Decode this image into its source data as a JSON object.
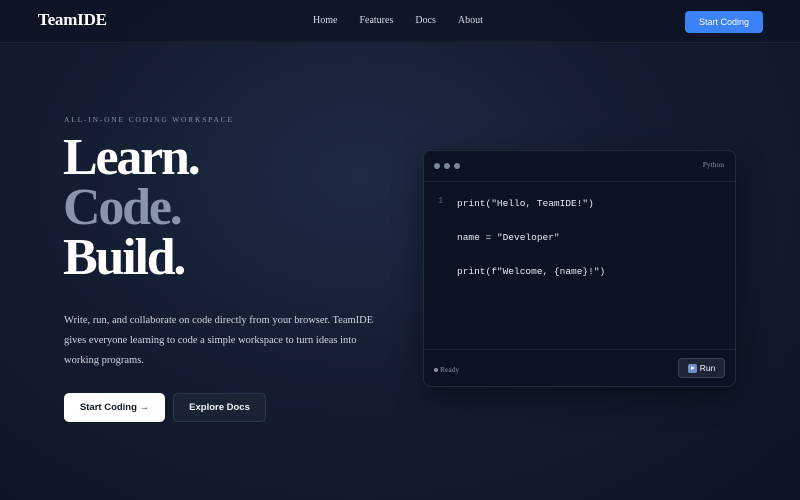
{
  "nav": {
    "brand": "TeamIDE",
    "links": [
      {
        "label": "Home"
      },
      {
        "label": "Features"
      },
      {
        "label": "Docs"
      },
      {
        "label": "About"
      }
    ],
    "cta_label": "Start Coding"
  },
  "hero": {
    "eyebrow": "ALL-IN-ONE CODING WORKSPACE",
    "headline": [
      "Learn.",
      "Code.",
      "Build."
    ],
    "description": "Write, run, and collaborate on code directly from your browser. TeamIDE gives everyone learning to code a simple workspace to turn ideas into working programs.",
    "primary_button": "Start Coding →",
    "secondary_button": "Explore Docs"
  },
  "editor": {
    "language": "Python",
    "line_numbers": [
      "1"
    ],
    "code_lines": [
      "print(\"Hello, TeamIDE!\")",
      "name = \"Developer\"",
      "print(f\"Welcome, {name}!\")"
    ],
    "status": "Ready",
    "run_label": "Run"
  },
  "colors": {
    "accent": "#3b82f6",
    "background": "#141d31",
    "headline_muted": "#8995ab"
  },
  "icons": [
    "window-dots-icon",
    "status-dot-icon",
    "play-icon"
  ]
}
